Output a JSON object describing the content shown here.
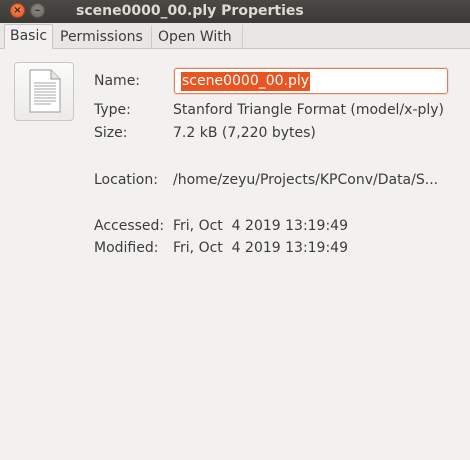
{
  "window": {
    "title": "scene0000_00.ply Properties",
    "close_glyph": "×",
    "minimize_glyph": "–"
  },
  "tabs": [
    {
      "label": "Basic",
      "active": true
    },
    {
      "label": "Permissions",
      "active": false
    },
    {
      "label": "Open With",
      "active": false
    }
  ],
  "basic": {
    "icon": "document-icon",
    "name_label": "Name:",
    "name_value": "scene0000_00.ply",
    "type_label": "Type:",
    "type_value": "Stanford Triangle Format (model/x-ply)",
    "size_label": "Size:",
    "size_value": "7.2 kB (7,220 bytes)",
    "location_label": "Location:",
    "location_value": "/home/zeyu/Projects/KPConv/Data/S...",
    "accessed_label": "Accessed:",
    "accessed_value": "Fri, Oct  4 2019 13:19:49",
    "modified_label": "Modified:",
    "modified_value": "Fri, Oct  4 2019 13:19:49"
  },
  "colors": {
    "accent": "#e95420",
    "titlebar": "#3b3a36",
    "background": "#f2f1f0"
  }
}
